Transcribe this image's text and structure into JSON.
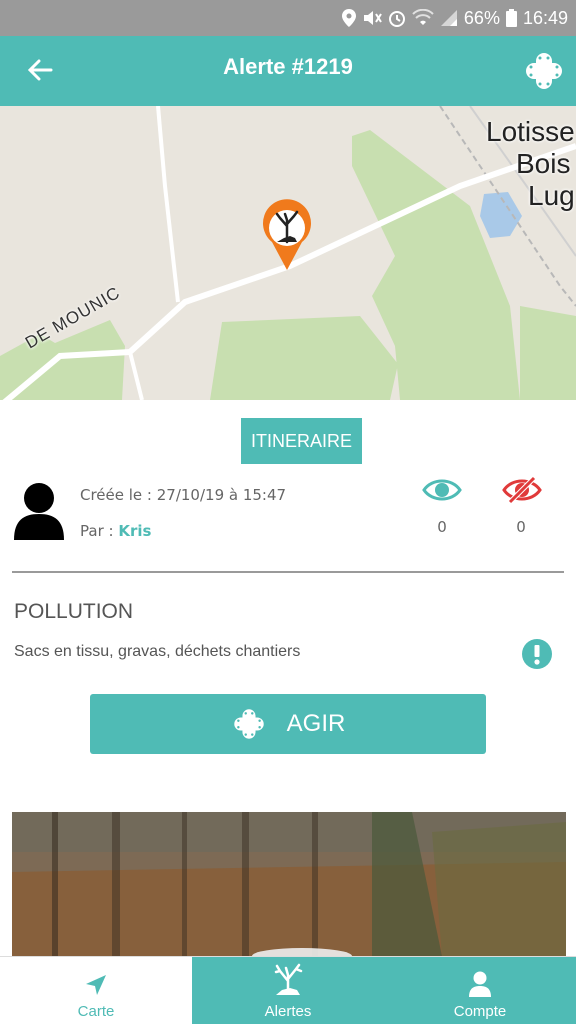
{
  "status_bar": {
    "battery": "66%",
    "time": "16:49"
  },
  "header": {
    "title": "Alerte #1219",
    "back_icon": "arrow-left-icon",
    "action_icon": "bandage-plus-icon"
  },
  "map": {
    "place_label_line1": "Lotisse",
    "place_label_line2": "Bois",
    "place_label_line3": "Lug",
    "road_label": "DE MOUNIC",
    "marker_icon": "polluted-tree-marker-icon"
  },
  "itinerary_button": {
    "label": "ITINERAIRE"
  },
  "alert_info": {
    "created_label": "Créée le : 27/10/19 à 15:47",
    "author_prefix": "Par : ",
    "author_name": "Kris",
    "views_count": "0",
    "hidden_count": "0"
  },
  "alert": {
    "category": "POLLUTION",
    "description": "Sacs en tissu, gravas, déchets chantiers"
  },
  "act_button": {
    "label": "AGIR"
  },
  "bottom_nav": {
    "items": [
      {
        "label": "Carte",
        "icon": "navigation-arrow-icon"
      },
      {
        "label": "Alertes",
        "icon": "tree-alert-icon"
      },
      {
        "label": "Compte",
        "icon": "user-icon"
      }
    ]
  },
  "colors": {
    "accent": "#4fbbb5",
    "marker": "#f07a1c",
    "hidden_icon": "#e03a3a"
  }
}
